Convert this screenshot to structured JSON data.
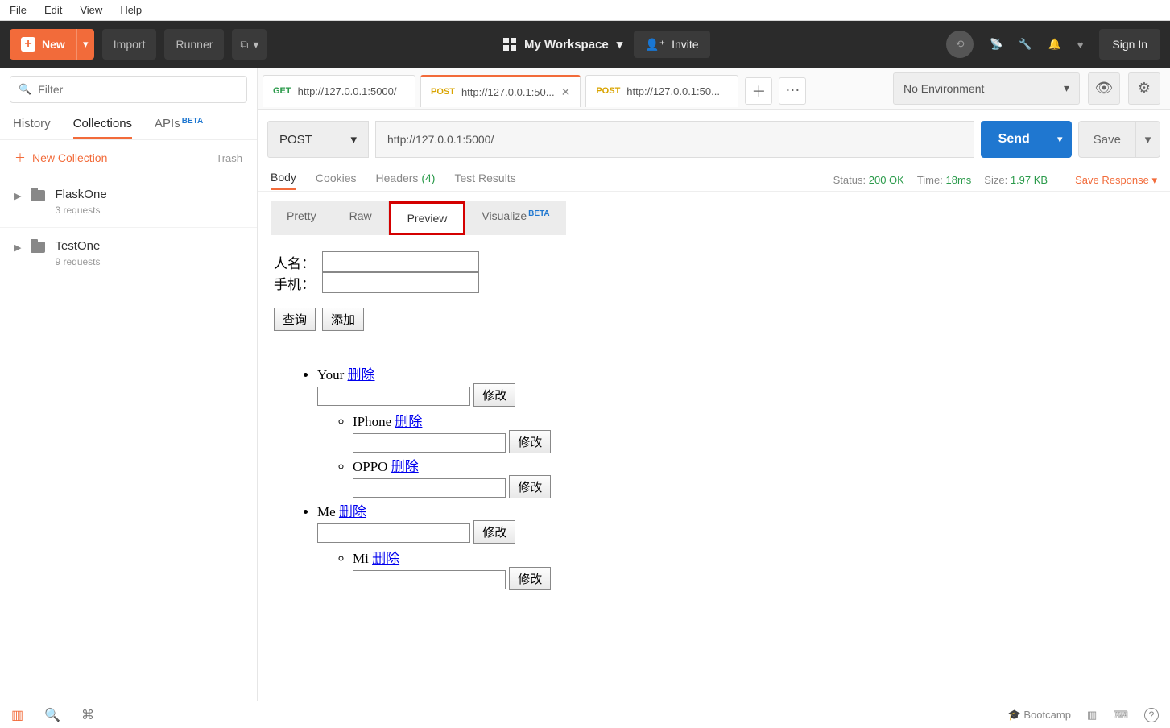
{
  "menu": {
    "file": "File",
    "edit": "Edit",
    "view": "View",
    "help": "Help"
  },
  "toolbar": {
    "new": "New",
    "import": "Import",
    "runner": "Runner",
    "workspace": "My Workspace",
    "invite": "Invite",
    "signin": "Sign In"
  },
  "sidebar": {
    "filter_placeholder": "Filter",
    "tabs": {
      "history": "History",
      "collections": "Collections",
      "apis": "APIs",
      "beta": "BETA"
    },
    "new_collection": "New Collection",
    "trash": "Trash",
    "collections": [
      {
        "name": "FlaskOne",
        "sub": "3 requests"
      },
      {
        "name": "TestOne",
        "sub": "9 requests"
      }
    ]
  },
  "reqtabs": [
    {
      "method": "GET",
      "label": "http://127.0.0.1:5000/",
      "active": false,
      "closable": false
    },
    {
      "method": "POST",
      "label": "http://127.0.0.1:50...",
      "active": true,
      "closable": true
    },
    {
      "method": "POST",
      "label": "http://127.0.0.1:50...",
      "active": false,
      "closable": false
    }
  ],
  "env": {
    "label": "No Environment"
  },
  "request": {
    "method": "POST",
    "url": "http://127.0.0.1:5000/",
    "send": "Send",
    "save": "Save"
  },
  "resp_tabs": {
    "body": "Body",
    "cookies": "Cookies",
    "headers": "Headers",
    "hdr_count": "(4)",
    "test": "Test Results",
    "status_label": "Status:",
    "status_val": "200 OK",
    "time_label": "Time:",
    "time_val": "18ms",
    "size_label": "Size:",
    "size_val": "1.97 KB",
    "save_response": "Save Response"
  },
  "viewtabs": {
    "pretty": "Pretty",
    "raw": "Raw",
    "preview": "Preview",
    "visualize": "Visualize",
    "beta": "BETA"
  },
  "preview": {
    "name_label": "人名：",
    "phone_label": "手机：",
    "query": "查询",
    "add": "添加",
    "delete": "删除",
    "modify": "修改",
    "items": [
      {
        "name": "Your",
        "children": [
          {
            "name": "IPhone"
          },
          {
            "name": "OPPO"
          }
        ]
      },
      {
        "name": "Me",
        "children": [
          {
            "name": "Mi"
          }
        ]
      }
    ]
  },
  "statusbar": {
    "bootcamp": "Bootcamp"
  }
}
